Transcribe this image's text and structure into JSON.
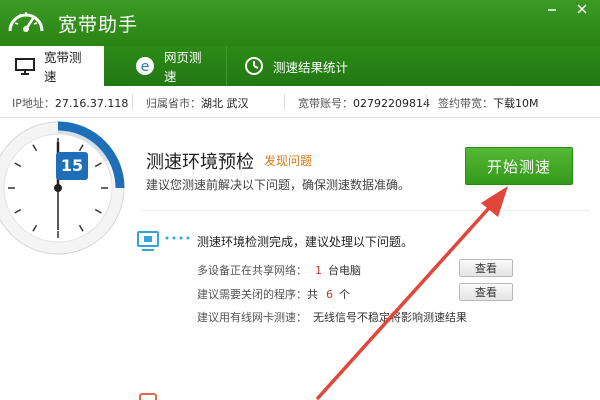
{
  "app": {
    "title": "宽带助手"
  },
  "window_controls": [
    "minimize-icon",
    "close-icon"
  ],
  "tabs": [
    {
      "label": "宽带测速",
      "icon": "monitor-icon",
      "active": true
    },
    {
      "label": "网页测速",
      "icon": "browser-icon",
      "active": false
    },
    {
      "label": "测速结果统计",
      "icon": "clock-icon",
      "active": false
    }
  ],
  "info": {
    "ip_label": "IP地址：",
    "ip_value": "27.16.37.118",
    "region_label": "归属省市：",
    "region_value": "湖北 武汉",
    "account_label": "宽带账号：",
    "account_value": "02792209814",
    "bandwidth_label": "签约带宽：",
    "bandwidth_value": "下载10M"
  },
  "gauge": {
    "value": "15"
  },
  "precheck": {
    "title": "测速环境预检",
    "link": "发现问题",
    "desc": "建议您测速前解决以下问题，确保测速数据准确。",
    "start_button": "开始测速"
  },
  "result": {
    "title": "测速环境检测完成，建议处理以下问题。",
    "rows": [
      {
        "label": "多设备正在共享网络：",
        "count": "1",
        "suffix": "台电脑",
        "button": "查看"
      },
      {
        "label": "建议需要关闭的程序：",
        "prefix": "共",
        "count": "6",
        "suffix": "个",
        "button": "查看"
      },
      {
        "label": "建议用有线网卡测速：",
        "note": "无线信号不稳定将影响测速结果"
      }
    ]
  },
  "colors": {
    "brand_green": "#2f8d1a",
    "gauge_blue": "#1f6fb8",
    "link_orange": "#d97a1a",
    "arrow_red": "#e0463a"
  }
}
